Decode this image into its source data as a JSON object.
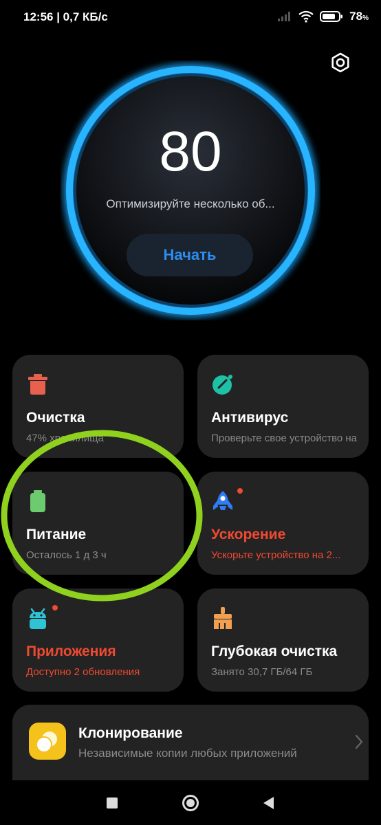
{
  "status_bar": {
    "left_text": "12:56 | 0,7 КБ/с",
    "battery_pct": "78",
    "battery_unit": "%",
    "icons": [
      "signal-icon",
      "wifi-icon",
      "battery-icon"
    ]
  },
  "header": {
    "settings_icon": "gear-icon"
  },
  "score_panel": {
    "score": "80",
    "description": "Оптимизируйте несколько об...",
    "start_label": "Начать",
    "ring_color": "#1ea8ff"
  },
  "cards": [
    {
      "title": "Очистка",
      "subtitle": "47% хранилища",
      "icon": "trash-icon",
      "icon_color": "#e8614f",
      "alert": false
    },
    {
      "title": "Антивирус",
      "subtitle": "Проверьте свое устройство на",
      "icon": "shield-check-icon",
      "icon_color": "#1fc1a6",
      "alert": false
    },
    {
      "title": "Питание",
      "subtitle": "Осталось 1 д 3 ч",
      "icon": "battery-icon",
      "icon_color": "#6ccb6e",
      "alert": false
    },
    {
      "title": "Ускорение",
      "subtitle": "Ускорьте устройство на 2...",
      "icon": "rocket-icon",
      "icon_color": "#2f7df6",
      "alert": true
    },
    {
      "title": "Приложения",
      "subtitle": "Доступно 2 обновления",
      "icon": "android-icon",
      "icon_color": "#2ec4d6",
      "alert": true
    },
    {
      "title": "Глубокая очистка",
      "subtitle": "Занято 30,7 ГБ/64 ГБ",
      "icon": "brush-icon",
      "icon_color": "#f0a050",
      "alert": false
    }
  ],
  "clone_card": {
    "title": "Клонирование",
    "subtitle": "Независимые копии любых приложений",
    "icon": "clone-app-icon"
  },
  "annotation": {
    "color": "#8fd11e"
  },
  "navbar": {
    "buttons": [
      "recents-icon",
      "home-icon",
      "back-icon"
    ]
  }
}
